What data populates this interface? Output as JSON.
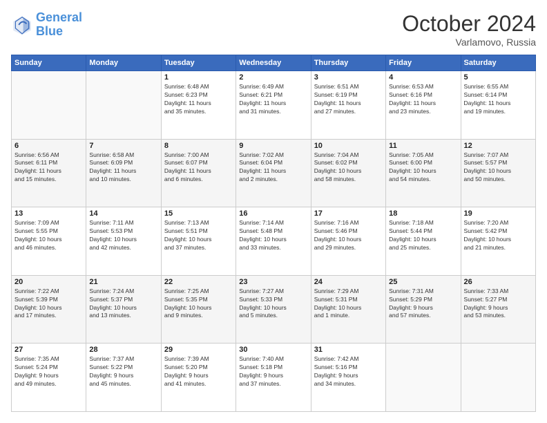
{
  "header": {
    "logo_line1": "General",
    "logo_line2": "Blue",
    "month": "October 2024",
    "location": "Varlamovo, Russia"
  },
  "days_of_week": [
    "Sunday",
    "Monday",
    "Tuesday",
    "Wednesday",
    "Thursday",
    "Friday",
    "Saturday"
  ],
  "weeks": [
    [
      {
        "day": "",
        "content": ""
      },
      {
        "day": "",
        "content": ""
      },
      {
        "day": "1",
        "content": "Sunrise: 6:48 AM\nSunset: 6:23 PM\nDaylight: 11 hours\nand 35 minutes."
      },
      {
        "day": "2",
        "content": "Sunrise: 6:49 AM\nSunset: 6:21 PM\nDaylight: 11 hours\nand 31 minutes."
      },
      {
        "day": "3",
        "content": "Sunrise: 6:51 AM\nSunset: 6:19 PM\nDaylight: 11 hours\nand 27 minutes."
      },
      {
        "day": "4",
        "content": "Sunrise: 6:53 AM\nSunset: 6:16 PM\nDaylight: 11 hours\nand 23 minutes."
      },
      {
        "day": "5",
        "content": "Sunrise: 6:55 AM\nSunset: 6:14 PM\nDaylight: 11 hours\nand 19 minutes."
      }
    ],
    [
      {
        "day": "6",
        "content": "Sunrise: 6:56 AM\nSunset: 6:11 PM\nDaylight: 11 hours\nand 15 minutes."
      },
      {
        "day": "7",
        "content": "Sunrise: 6:58 AM\nSunset: 6:09 PM\nDaylight: 11 hours\nand 10 minutes."
      },
      {
        "day": "8",
        "content": "Sunrise: 7:00 AM\nSunset: 6:07 PM\nDaylight: 11 hours\nand 6 minutes."
      },
      {
        "day": "9",
        "content": "Sunrise: 7:02 AM\nSunset: 6:04 PM\nDaylight: 11 hours\nand 2 minutes."
      },
      {
        "day": "10",
        "content": "Sunrise: 7:04 AM\nSunset: 6:02 PM\nDaylight: 10 hours\nand 58 minutes."
      },
      {
        "day": "11",
        "content": "Sunrise: 7:05 AM\nSunset: 6:00 PM\nDaylight: 10 hours\nand 54 minutes."
      },
      {
        "day": "12",
        "content": "Sunrise: 7:07 AM\nSunset: 5:57 PM\nDaylight: 10 hours\nand 50 minutes."
      }
    ],
    [
      {
        "day": "13",
        "content": "Sunrise: 7:09 AM\nSunset: 5:55 PM\nDaylight: 10 hours\nand 46 minutes."
      },
      {
        "day": "14",
        "content": "Sunrise: 7:11 AM\nSunset: 5:53 PM\nDaylight: 10 hours\nand 42 minutes."
      },
      {
        "day": "15",
        "content": "Sunrise: 7:13 AM\nSunset: 5:51 PM\nDaylight: 10 hours\nand 37 minutes."
      },
      {
        "day": "16",
        "content": "Sunrise: 7:14 AM\nSunset: 5:48 PM\nDaylight: 10 hours\nand 33 minutes."
      },
      {
        "day": "17",
        "content": "Sunrise: 7:16 AM\nSunset: 5:46 PM\nDaylight: 10 hours\nand 29 minutes."
      },
      {
        "day": "18",
        "content": "Sunrise: 7:18 AM\nSunset: 5:44 PM\nDaylight: 10 hours\nand 25 minutes."
      },
      {
        "day": "19",
        "content": "Sunrise: 7:20 AM\nSunset: 5:42 PM\nDaylight: 10 hours\nand 21 minutes."
      }
    ],
    [
      {
        "day": "20",
        "content": "Sunrise: 7:22 AM\nSunset: 5:39 PM\nDaylight: 10 hours\nand 17 minutes."
      },
      {
        "day": "21",
        "content": "Sunrise: 7:24 AM\nSunset: 5:37 PM\nDaylight: 10 hours\nand 13 minutes."
      },
      {
        "day": "22",
        "content": "Sunrise: 7:25 AM\nSunset: 5:35 PM\nDaylight: 10 hours\nand 9 minutes."
      },
      {
        "day": "23",
        "content": "Sunrise: 7:27 AM\nSunset: 5:33 PM\nDaylight: 10 hours\nand 5 minutes."
      },
      {
        "day": "24",
        "content": "Sunrise: 7:29 AM\nSunset: 5:31 PM\nDaylight: 10 hours\nand 1 minute."
      },
      {
        "day": "25",
        "content": "Sunrise: 7:31 AM\nSunset: 5:29 PM\nDaylight: 9 hours\nand 57 minutes."
      },
      {
        "day": "26",
        "content": "Sunrise: 7:33 AM\nSunset: 5:27 PM\nDaylight: 9 hours\nand 53 minutes."
      }
    ],
    [
      {
        "day": "27",
        "content": "Sunrise: 7:35 AM\nSunset: 5:24 PM\nDaylight: 9 hours\nand 49 minutes."
      },
      {
        "day": "28",
        "content": "Sunrise: 7:37 AM\nSunset: 5:22 PM\nDaylight: 9 hours\nand 45 minutes."
      },
      {
        "day": "29",
        "content": "Sunrise: 7:39 AM\nSunset: 5:20 PM\nDaylight: 9 hours\nand 41 minutes."
      },
      {
        "day": "30",
        "content": "Sunrise: 7:40 AM\nSunset: 5:18 PM\nDaylight: 9 hours\nand 37 minutes."
      },
      {
        "day": "31",
        "content": "Sunrise: 7:42 AM\nSunset: 5:16 PM\nDaylight: 9 hours\nand 34 minutes."
      },
      {
        "day": "",
        "content": ""
      },
      {
        "day": "",
        "content": ""
      }
    ]
  ]
}
